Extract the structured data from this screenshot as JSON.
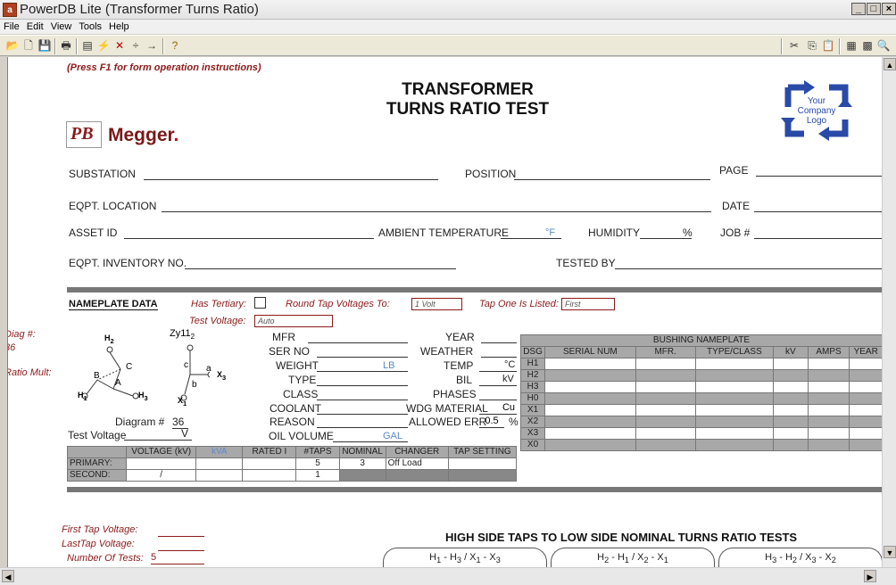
{
  "window": {
    "title": "PowerDB Lite (Transformer Turns Ratio)",
    "icon": "powerdb-icon",
    "min": "_",
    "max": "□",
    "close": "×"
  },
  "menu": [
    "File",
    "Edit",
    "View",
    "Tools",
    "Help"
  ],
  "toolbar": {
    "left": [
      "open-icon",
      "new-icon",
      "save-icon",
      "print-icon",
      "form-icon",
      "flag-icon",
      "delete-icon",
      "plus-minus-icon",
      "arrow-icon",
      "help-icon"
    ],
    "right": [
      "cut-icon",
      "copy-icon",
      "paste-icon",
      "sheet-icon",
      "calc-icon",
      "zoom-icon",
      "find-icon"
    ]
  },
  "form": {
    "instructions": "(Press F1 for form operation instructions)",
    "title1": "TRANSFORMER",
    "title2": "TURNS RATIO TEST",
    "megger": "Megger",
    "megger_dot": ".",
    "logo_text": [
      "Your",
      "Company",
      "Logo"
    ],
    "fields": {
      "substation": "SUBSTATION",
      "position": "POSITION",
      "page": "PAGE",
      "eqpt_location": "EQPT. LOCATION",
      "date": "DATE",
      "asset_id": "ASSET ID",
      "ambient": "AMBIENT TEMPERATURE",
      "deg_f": "°F",
      "humidity": "HUMIDITY",
      "pct": "%",
      "job": "JOB #",
      "inventory": "EQPT. INVENTORY NO.",
      "tested_by": "TESTED BY"
    },
    "nameplate": {
      "header": "NAMEPLATE DATA",
      "has_tertiary": "Has Tertiary:",
      "round_tap": "Round Tap Voltages To:",
      "round_val": "1 Volt",
      "tap_one": "Tap One Is Listed:",
      "tap_one_val": "First",
      "test_voltage_lbl": "Test Voltage:",
      "test_voltage_val": "Auto"
    },
    "diag": {
      "diag_num_lbl": "Diag #:",
      "diag_num": "36",
      "ratio_mult": "Ratio Mult:",
      "vector": "Zy11",
      "h2": "H",
      "h2s": "2",
      "h1": "H",
      "h1s": "1",
      "h3": "H",
      "h3s": "3",
      "x2": "X",
      "x2s": "2",
      "x1": "X",
      "x1s": "1",
      "x3": "X",
      "x3s": "3",
      "a": "a",
      "b": "b",
      "c": "c",
      "A": "A",
      "B": "B",
      "C": "C",
      "diagram_lbl": "Diagram #",
      "diagram_val": "36",
      "test_voltage": "Test Voltage",
      "tv_val": "V"
    },
    "mid": {
      "mfr": "MFR",
      "serno": "SER NO",
      "weight": "WEIGHT",
      "lb": "LB",
      "type": "TYPE",
      "class": "CLASS",
      "coolant": "COOLANT",
      "reason": "REASON",
      "oilvol": "OIL VOLUME",
      "gal": "GAL",
      "year": "YEAR",
      "weather": "WEATHER",
      "temp": "TEMP",
      "degc": "°C",
      "bil": "BIL",
      "kv": "kV",
      "phases": "PHASES",
      "wdg": "WDG MATERIAL",
      "cu": "Cu",
      "allowed": "ALLOWED ERR",
      "err": "0.5",
      "errpct": "%"
    },
    "ratings": {
      "headers": [
        "",
        "VOLTAGE (kV)",
        "kVA",
        "RATED I",
        "#TAPS",
        "NOMINAL",
        "CHANGER",
        "TAP SETTING"
      ],
      "rows": [
        [
          "PRIMARY:",
          "",
          "",
          "",
          "5",
          "3",
          "Off Load",
          ""
        ],
        [
          "SECOND:",
          "/",
          "",
          "",
          "1",
          "",
          "",
          ""
        ]
      ]
    },
    "bushing": {
      "title": "BUSHING NAMEPLATE",
      "headers": [
        "DSG",
        "SERIAL NUM",
        "MFR.",
        "TYPE/CLASS",
        "kV",
        "AMPS",
        "YEAR"
      ],
      "rows": [
        "H1",
        "H2",
        "H3",
        "H0",
        "X1",
        "X2",
        "X3",
        "X0"
      ]
    },
    "taps": {
      "first": "First Tap Voltage:",
      "last": "LastTap Voltage:",
      "num": "Number Of Tests:",
      "num_val": "5"
    },
    "hs_title": "HIGH SIDE TAPS TO LOW SIDE NOMINAL TURNS RATIO TESTS",
    "tabs": [
      [
        "H",
        "1",
        " - H",
        "3",
        " / X",
        "1",
        " - X",
        "3"
      ],
      [
        "H",
        "2",
        " - H",
        "1",
        " / X",
        "2",
        " - X",
        "1"
      ],
      [
        "H",
        "3",
        " - H",
        "2",
        " / X",
        "3",
        " - X",
        "2"
      ]
    ]
  }
}
